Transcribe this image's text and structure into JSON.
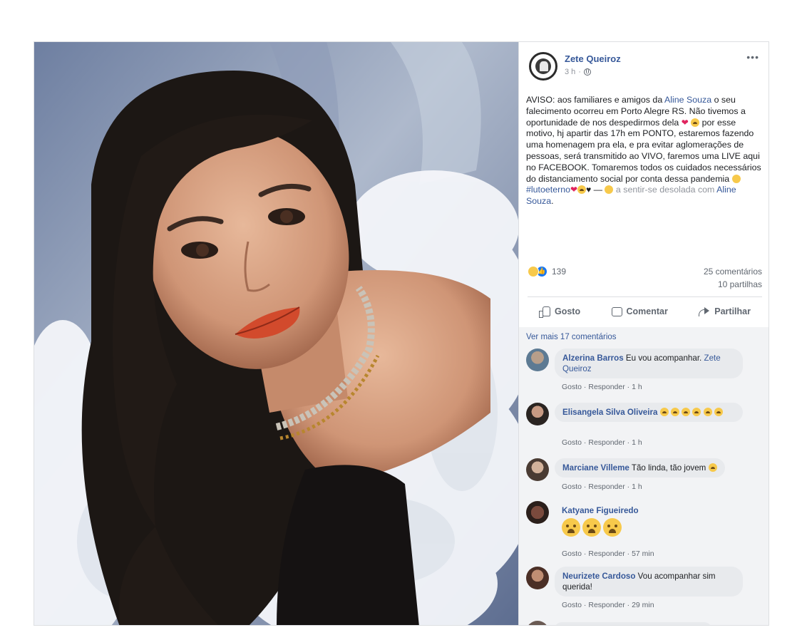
{
  "post": {
    "author": "Zete Queiroz",
    "time": "3 h",
    "more": "•••",
    "text_parts": {
      "p1": "AVISO: aos familiares e amigos da ",
      "tag1": "Aline Souza",
      "p2": " o seu falecimento ocorreu em Porto Alegre RS. Não tivemos a oportunidade de nos despedirmos dela ",
      "p3": " por esse motivo, hj apartir das 17h em PONTO, estaremos fazendo uma homenagem pra ela, e pra evitar aglomerações de pessoas, será transmitido ao VIVO, faremos uma LIVE aqui no FACEBOOK. Tomaremos todos os cuidados necessários do distanciamento social por conta dessa pandemia ",
      "hashtag": "#lutoeterno",
      "dash": " — ",
      "feeling": " a sentir-se desolada com ",
      "tag2": "Aline Souza",
      "end": "."
    },
    "reactions_count": "139",
    "comments_count": "25 comentários",
    "shares_count": "10 partilhas"
  },
  "actions": {
    "like": "Gosto",
    "comment": "Comentar",
    "share": "Partilhar"
  },
  "comments_section": {
    "view_more": "Ver mais 17 comentários",
    "items": [
      {
        "name": "Alzerina Barros",
        "text": " Eu vou acompanhar. ",
        "tag": "Zete Queiroz",
        "like": "Gosto",
        "reply": "Responder",
        "time": "1 h"
      },
      {
        "name": "Elisangela Silva Oliveira",
        "text": "",
        "like": "Gosto",
        "reply": "Responder",
        "time": "1 h"
      },
      {
        "name": "Marciane Villeme",
        "text": " Tão linda, tão jovem ",
        "like": "Gosto",
        "reply": "Responder",
        "time": "1 h"
      },
      {
        "name": "Katyane Figueiredo",
        "text": "",
        "like": "Gosto",
        "reply": "Responder",
        "time": "57 min"
      },
      {
        "name": "Neurizete Cardoso",
        "text": " Vou acompanhar sim querida!",
        "like": "Gosto",
        "reply": "Responder",
        "time": "29 min"
      }
    ]
  },
  "icons": [
    "globe-icon",
    "more-icon",
    "like-icon",
    "comment-icon",
    "share-icon",
    "sad-reaction-icon",
    "like-reaction-icon",
    "crying-emoji-icon",
    "heart-emoji-icon"
  ],
  "colors": {
    "link": "#365899",
    "meta": "#90949c",
    "bubble": "#e8eaed",
    "like_blue": "#1877f2",
    "heart": "#e0245e"
  }
}
